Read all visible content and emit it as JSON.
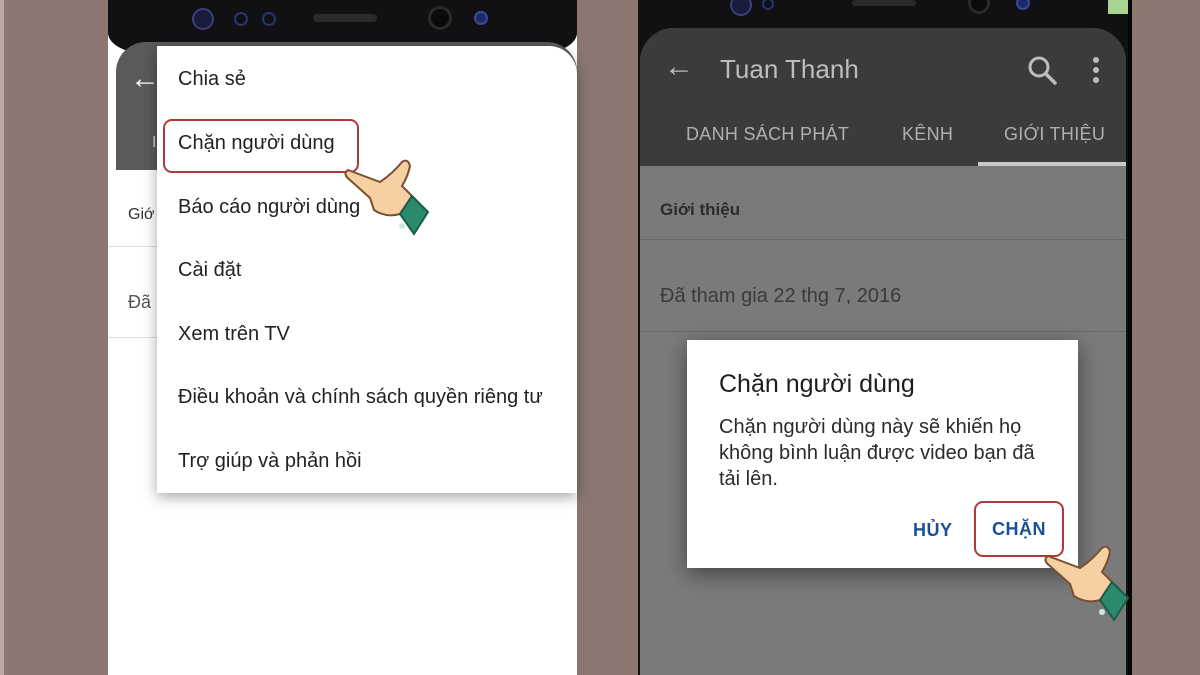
{
  "left_phone": {
    "menu": {
      "items": [
        "Chia sẻ",
        "Chặn người dùng",
        "Báo cáo người dùng",
        "Cài đặt",
        "Xem trên TV",
        "Điều khoản và chính sách quyền riêng tư",
        "Trợ giúp và phản hồi"
      ],
      "highlighted": "Chặn người dùng"
    },
    "background": {
      "back_icon": "←",
      "row_about_partial": "Giớ",
      "row_joined_partial": "Đã",
      "tab_partial": "I"
    }
  },
  "right_phone": {
    "appbar": {
      "back_icon": "←",
      "title": "Tuan Thanh",
      "search_icon": "search-icon",
      "more_icon": "more-vert-icon"
    },
    "tabs": [
      {
        "label": "DANH SÁCH PHÁT",
        "active": false
      },
      {
        "label": "KÊNH",
        "active": false
      },
      {
        "label": "GIỚI THIỆU",
        "active": true
      }
    ],
    "about": {
      "section_title": "Giới thiệu",
      "joined": "Đã tham gia 22 thg 7, 2016"
    },
    "dialog": {
      "title": "Chặn người dùng",
      "body": "Chặn người dùng này sẽ khiến họ không bình luận được video bạn đã tải lên.",
      "cancel_label": "HỦY",
      "confirm_label": "CHẶN"
    }
  },
  "colors": {
    "background": "#8b7770",
    "highlight_border": "#b03a3a",
    "dialog_button": "#1a4f94",
    "dark_appbar": "#3b3b3b"
  }
}
